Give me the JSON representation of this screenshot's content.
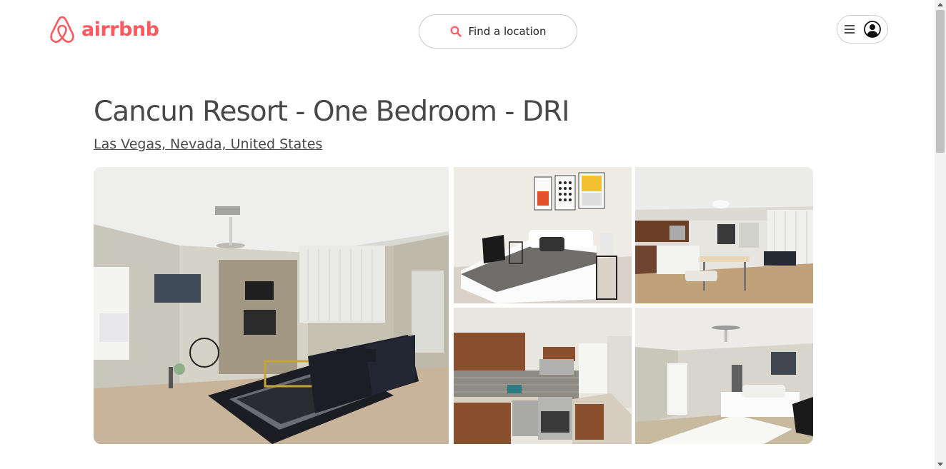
{
  "header": {
    "logo_text": "airrbnb",
    "search_label": "Find a location",
    "icons": {
      "logo": "airbnb-belo-icon",
      "search": "search-icon",
      "menu": "hamburger-menu-icon",
      "avatar": "user-avatar-icon"
    }
  },
  "listing": {
    "title": "Cancun Resort - One Bedroom - DRI",
    "location": "Las Vegas, Nevada, United States"
  },
  "gallery": {
    "photos": [
      {
        "subject": "living room with fireplace"
      },
      {
        "subject": "bedroom"
      },
      {
        "subject": "open plan kitchen and dining"
      },
      {
        "subject": "kitchen"
      },
      {
        "subject": "bedroom with ceiling fan"
      }
    ]
  },
  "colors": {
    "brand": "#ff5a5f",
    "text": "#484848",
    "border": "#c8c8c8"
  }
}
